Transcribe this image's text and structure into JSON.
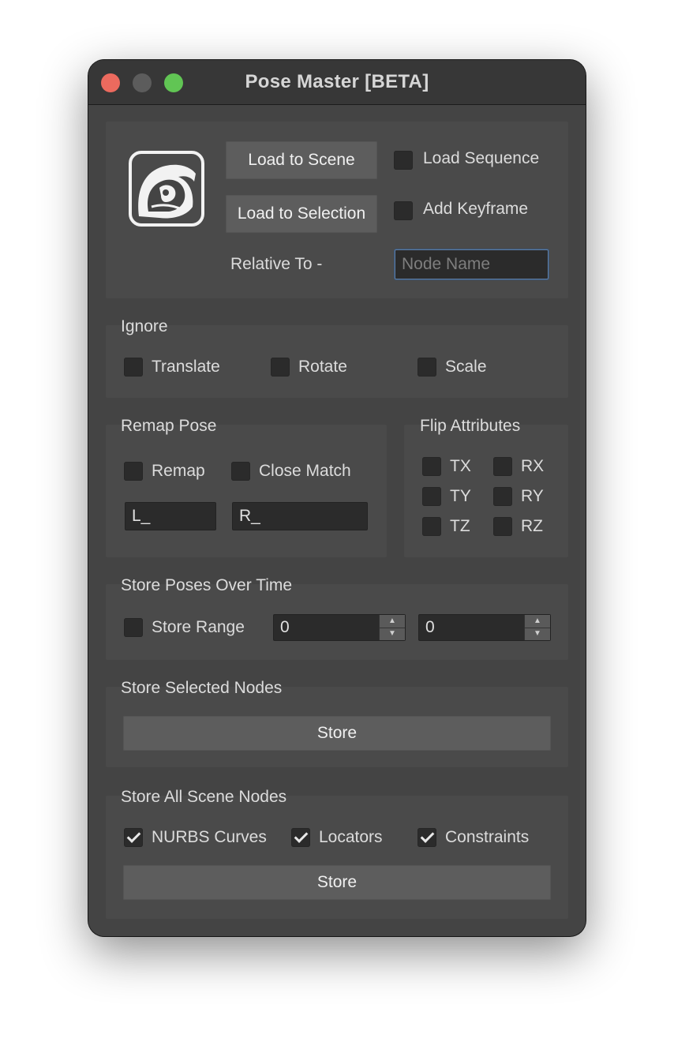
{
  "window": {
    "title": "Pose Master [BETA]"
  },
  "load": {
    "load_to_scene": "Load to Scene",
    "load_to_selection": "Load to Selection",
    "load_sequence": "Load Sequence",
    "add_keyframe": "Add Keyframe",
    "relative_to": "Relative To -",
    "node_name_placeholder": "Node Name"
  },
  "ignore": {
    "heading": "Ignore",
    "translate": "Translate",
    "rotate": "Rotate",
    "scale": "Scale"
  },
  "remap": {
    "heading": "Remap Pose",
    "remap": "Remap",
    "close_match": "Close Match",
    "left_value": "L_",
    "right_value": "R_"
  },
  "flip": {
    "heading": "Flip Attributes",
    "tx": "TX",
    "ty": "TY",
    "tz": "TZ",
    "rx": "RX",
    "ry": "RY",
    "rz": "RZ"
  },
  "store_time": {
    "heading": "Store Poses Over Time",
    "store_range": "Store Range",
    "start_value": "0",
    "end_value": "0"
  },
  "store_selected": {
    "heading": "Store Selected Nodes",
    "button": "Store"
  },
  "store_all": {
    "heading": "Store All Scene Nodes",
    "nurbs_curves": "NURBS Curves",
    "locators": "Locators",
    "constraints": "Constraints",
    "button": "Store"
  },
  "colors": {
    "close": "#ec6a5e",
    "maximize": "#61c554",
    "window_bg": "#444444",
    "panel_bg": "#4a4a4a"
  }
}
